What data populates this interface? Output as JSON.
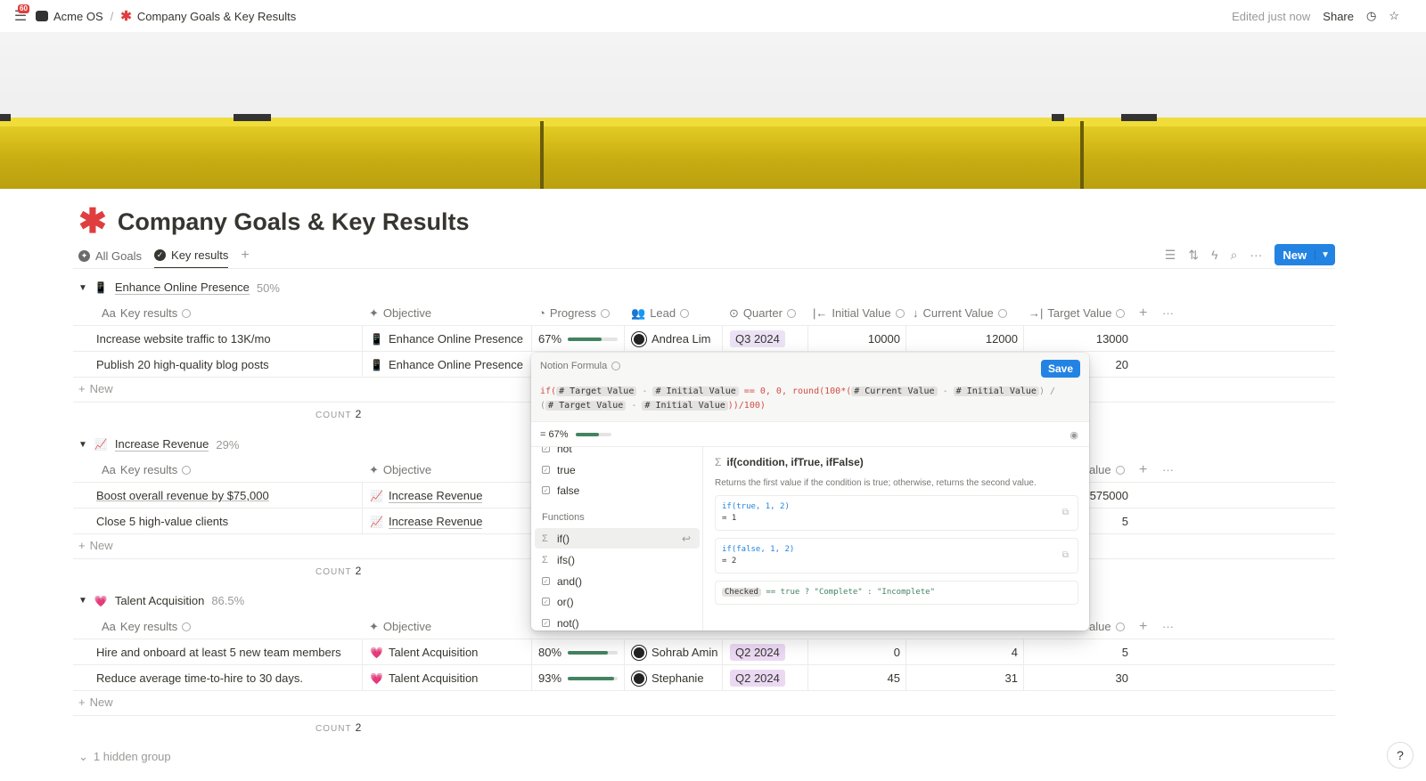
{
  "topbar": {
    "notif_count": "60",
    "workspace": "Acme OS",
    "separator": "/",
    "page": "Company Goals & Key Results",
    "edited": "Edited just now",
    "share": "Share"
  },
  "page": {
    "title": "Company Goals & Key Results"
  },
  "tabs": [
    {
      "label": "All Goals"
    },
    {
      "label": "Key results"
    }
  ],
  "toolbar": {
    "new_label": "New"
  },
  "columns": {
    "key_results": "Key results",
    "objective": "Objective",
    "progress": "Progress",
    "lead": "Lead",
    "quarter": "Quarter",
    "initial": "Initial Value",
    "current": "Current Value",
    "target": "Target Value",
    "aa": "Aa"
  },
  "groups": [
    {
      "name": "Enhance Online Presence",
      "emoji": "📱",
      "pct": "50%",
      "rows": [
        {
          "kr": "Increase website traffic to 13K/mo",
          "objective": "Enhance Online Presence",
          "progress": "67%",
          "progress_value": 0.67,
          "lead": "Andrea Lim",
          "quarter": "Q3 2024",
          "initial": "10000",
          "current": "12000",
          "target": "13000"
        },
        {
          "kr": "Publish 20 high-quality blog posts",
          "objective": "Enhance Online Presence",
          "target": "20"
        }
      ],
      "new": "New",
      "count_label": "COUNT",
      "count": "2"
    },
    {
      "name": "Increase Revenue",
      "emoji": "📈",
      "pct": "29%",
      "rows": [
        {
          "kr": "Boost overall revenue by $75,000",
          "objective": "Increase Revenue",
          "target": "575000"
        },
        {
          "kr": "Close 5 high-value clients",
          "objective": "Increase Revenue",
          "target": "5"
        }
      ],
      "new": "New",
      "count_label": "COUNT",
      "count": "2",
      "target_header_partial": "alue"
    },
    {
      "name": "Talent Acquisition",
      "emoji": "💗",
      "pct": "86.5%",
      "rows": [
        {
          "kr": "Hire and onboard at least 5 new team members",
          "objective": "Talent Acquisition",
          "progress": "80%",
          "progress_value": 0.8,
          "lead": "Sohrab Amin",
          "quarter": "Q2 2024",
          "initial": "0",
          "current": "4",
          "target": "5"
        },
        {
          "kr": "Reduce average time-to-hire to 30 days.",
          "objective": "Talent Acquisition",
          "progress": "93%",
          "progress_value": 0.93,
          "lead": "Stephanie",
          "quarter": "Q2 2024",
          "initial": "45",
          "current": "31",
          "target": "30"
        }
      ],
      "new": "New",
      "count_label": "COUNT",
      "count": "2",
      "target_header_partial": "alue"
    }
  ],
  "hidden_group": "1 hidden group",
  "formula": {
    "title": "Notion Formula",
    "save": "Save",
    "line1_parts": [
      "if(",
      "# Target Value",
      "-",
      "# Initial Value",
      "== 0, 0,",
      "round",
      "(100*(",
      "# Current Value",
      "-",
      "# Initial Value",
      ") /"
    ],
    "line2_parts": [
      "(",
      "# Target Value",
      "-",
      "# Initial Value",
      "))/100)"
    ],
    "result": "= 67%",
    "result_value": 0.67,
    "list": {
      "items_top": [
        "not",
        "true",
        "false"
      ],
      "section": "Functions",
      "functions": [
        "if()",
        "ifs()",
        "and()",
        "or()",
        "not()"
      ]
    },
    "detail": {
      "signature": "if(condition, ifTrue, ifFalse)",
      "description": "Returns the first value if the condition is true; otherwise, returns the second value.",
      "ex1_code": "if(true, 1, 2)",
      "ex1_result": "= 1",
      "ex2_code": "if(false, 1, 2)",
      "ex2_result": "= 2",
      "ex3_token": "Checked",
      "ex3_rest": "== true ? \"Complete\" : \"Incomplete\""
    }
  }
}
